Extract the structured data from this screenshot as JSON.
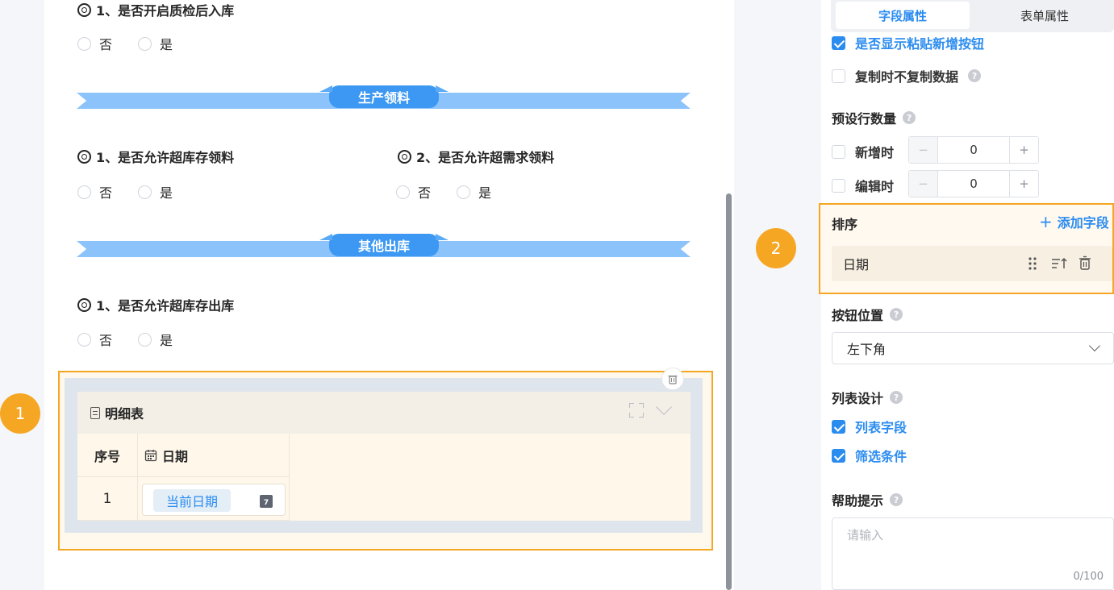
{
  "canvas": {
    "q1": {
      "title": "1、是否开启质检后入库",
      "opt_no": "否",
      "opt_yes": "是"
    },
    "banner1": "生产领料",
    "q2": {
      "title": "1、是否允许超库存领料",
      "opt_no": "否",
      "opt_yes": "是"
    },
    "q3": {
      "title": "2、是否允许超需求领料",
      "opt_no": "否",
      "opt_yes": "是"
    },
    "banner2": "其他出库",
    "q4": {
      "title": "1、是否允许超库存出库",
      "opt_no": "否",
      "opt_yes": "是"
    },
    "detail": {
      "title": "明细表",
      "col_index": "序号",
      "col_date": "日期",
      "row_index": "1",
      "date_value": "当前日期",
      "cal_day": "7"
    }
  },
  "badges": {
    "one": "1",
    "two": "2"
  },
  "panel": {
    "tabs": {
      "field": "字段属性",
      "form": "表单属性"
    },
    "show_paste_btn": {
      "label": "是否显示粘贴新增按钮",
      "checked": true
    },
    "copy_no_data": {
      "label": "复制时不复制数据",
      "checked": false
    },
    "preset_rows": {
      "title": "预设行数量",
      "on_add_label": "新增时",
      "on_add_value": "0",
      "on_edit_label": "编辑时",
      "on_edit_value": "0",
      "minus": "−",
      "plus": "+"
    },
    "sort": {
      "title": "排序",
      "add_field": "添加字段",
      "item": "日期"
    },
    "button_pos": {
      "title": "按钮位置",
      "value": "左下角"
    },
    "list_design": {
      "title": "列表设计",
      "list_fields": "列表字段",
      "filter_cond": "筛选条件"
    },
    "help_tip": {
      "title": "帮助提示",
      "placeholder": "请输入",
      "counter": "0/100"
    },
    "help_mark": "?"
  },
  "colors": {
    "accent": "#2b8cf0",
    "highlight": "#f5a623",
    "banner": "#3c98f2"
  }
}
